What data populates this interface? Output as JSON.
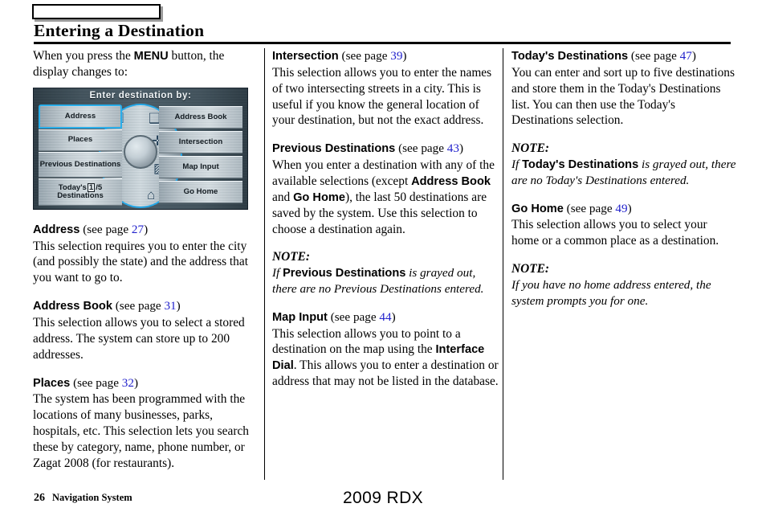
{
  "header": {
    "tab_label": "",
    "title": "Entering a Destination"
  },
  "column1": {
    "intro_pre": "When you press the ",
    "intro_bold": "MENU",
    "intro_post": " button, the display changes to:",
    "nav_screen": {
      "title": "Enter destination by:",
      "left_buttons": [
        {
          "label": "Address",
          "selected": true
        },
        {
          "label": "Places",
          "selected": false
        },
        {
          "label": "Previous Destinations",
          "selected": false
        },
        {
          "label": "Today's",
          "count": "1",
          "count_suffix": "/5",
          "label2": "Destinations",
          "selected": false
        }
      ],
      "right_buttons": [
        {
          "label": "Address Book"
        },
        {
          "label": "Intersection"
        },
        {
          "label": "Map Input"
        },
        {
          "label": "Go Home"
        }
      ],
      "icons": [
        "address-keypad-icon",
        "address-book-icon",
        "places-buildings-icon",
        "intersection-icon",
        "previous-destinations-icon",
        "map-input-icon",
        "todays-destinations-icon",
        "go-home-icon"
      ],
      "dial": "interface-dial"
    },
    "sections": [
      {
        "term": "Address",
        "see_page_pre": " (see page ",
        "page": "27",
        "see_page_post": ")",
        "body": "This selection requires you to enter the city (and possibly the state) and the address that you want to go to."
      },
      {
        "term": "Address Book",
        "see_page_pre": " (see page ",
        "page": "31",
        "see_page_post": ")",
        "body": "This selection allows you to select a stored address. The system can store up to 200 addresses."
      },
      {
        "term": "Places",
        "see_page_pre": " (see page ",
        "page": "32",
        "see_page_post": ")",
        "body": "The system has been programmed with the locations of many businesses, parks, hospitals, etc. This selection lets you search these by category, name, phone number, or Zagat 2008 (for restaurants)."
      }
    ]
  },
  "column2": {
    "sections": [
      {
        "term": "Intersection",
        "see_page_pre": " (see page ",
        "page": "39",
        "see_page_post": ")",
        "body": "This selection allows you to enter the names of two intersecting streets in a city. This is useful if you know the general location of your destination, but not the exact address."
      },
      {
        "term": "Previous Destinations",
        "see_page_pre": " (see page ",
        "page": "43",
        "see_page_post": ")",
        "body_part1": "When you enter a destination with any of the available selections (except ",
        "body_bold1": "Address Book",
        "body_part2": " and ",
        "body_bold2": "Go Home",
        "body_part3": "), the last 50 destinations are saved by the system. Use this selection to choose a destination again."
      }
    ],
    "note": {
      "title": "NOTE:",
      "part1": "If ",
      "bold1": "Previous Destinations",
      "part2": " is grayed out, there are no Previous Destinations entered."
    },
    "map_input": {
      "term": "Map Input",
      "see_page_pre": " (see page ",
      "page": "44",
      "see_page_post": ")",
      "body_part1": "This selection allows you to point to a destination on the map using the ",
      "body_bold1": "Interface Dial",
      "body_part2": ". This allows you to enter a destination or address that may not be listed in the database."
    }
  },
  "column3": {
    "todays": {
      "term": "Today's Destinations",
      "see_page_pre": " (see page ",
      "page": "47",
      "see_page_post": ")",
      "body": "You can enter and sort up to five destinations and store them in the Today's Destinations list. You can then use the Today's Destinations selection."
    },
    "note1": {
      "title": "NOTE:",
      "part1": "If ",
      "bold1": "Today's Destinations",
      "part2": " is grayed out, there are no Today's Destinations entered."
    },
    "go_home": {
      "term": "Go Home",
      "see_page_pre": " (see page ",
      "page": "49",
      "see_page_post": ")",
      "body": "This selection allows you to select your home or a common place as a destination."
    },
    "note2": {
      "title": "NOTE:",
      "body": "If you have no home address entered, the system prompts you for one."
    }
  },
  "footer": {
    "page_number": "26",
    "section_label": "Navigation System",
    "model": "2009  RDX"
  },
  "colors": {
    "page_link": "#2222cc",
    "nav_highlight": "#2aaeea",
    "nav_bg_dark": "#3c4d57"
  }
}
